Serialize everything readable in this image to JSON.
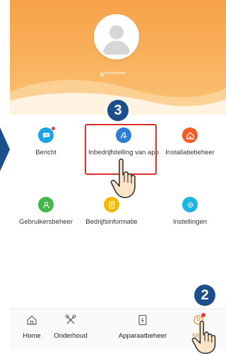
{
  "header": {
    "username": "a*******"
  },
  "steps": {
    "step3": "3",
    "step2": "2"
  },
  "grid": {
    "bericht": "Bericht",
    "inbedrijfstelling": "Inbedrijfstelling van app",
    "installatiebeheer": "Installatiebeheer",
    "gebruikersbeheer": "Gebruikersbeheer",
    "bedrijfsinformatie": "Bedrijfsinformatie",
    "instellingen": "Instellingen"
  },
  "nav": {
    "home": "Home",
    "onderhoud": "Onderhoud",
    "apparaatbeheer": "Apparaatbeheer",
    "mijn": "Mijn"
  },
  "colors": {
    "accent_orange": "#f7a24a",
    "step_blue": "#1c4e8c",
    "highlight_red": "#e0302a",
    "bericht_icon": "#1aa3e8",
    "inbedrijf_icon": "#2d7fd6",
    "install_icon": "#f45a26",
    "gebruiker_icon": "#43b649",
    "bedrijf_icon": "#f5b800",
    "instel_icon": "#1ab6e4"
  },
  "icons": {
    "bericht": "chat-bubble-icon",
    "inbedrijf": "signature-icon",
    "install": "house-icon",
    "gebruiker": "user-icon",
    "bedrijf": "document-icon",
    "instel": "gear-icon",
    "home": "home-icon",
    "onderhoud": "tools-icon",
    "apparaat": "device-icon",
    "mijn": "profile-icon"
  }
}
